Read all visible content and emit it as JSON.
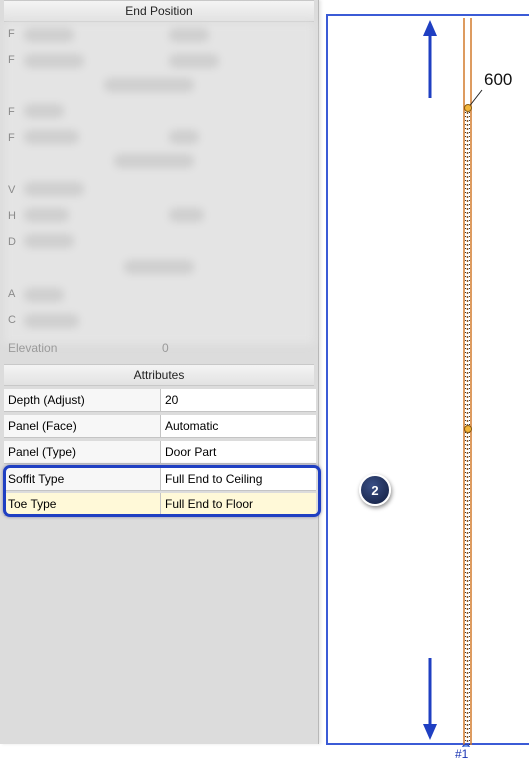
{
  "panel": {
    "end_position_header": "End Position",
    "elevation_label": "Elevation",
    "elevation_value": "0",
    "hint_letters": [
      "F",
      "F",
      "F",
      "F",
      "V",
      "H",
      "D",
      "A",
      "C"
    ],
    "attributes_header": "Attributes",
    "rows": [
      {
        "name": "Depth (Adjust)",
        "value": "20"
      },
      {
        "name": "Panel (Face)",
        "value": "Automatic"
      },
      {
        "name": "Panel (Type)",
        "value": "Door Part"
      },
      {
        "name": "Soffit Type",
        "value": "Full End to Ceiling"
      },
      {
        "name": "Toe Type",
        "value": "Full End to Floor"
      }
    ]
  },
  "drawing": {
    "dimension_label": "600",
    "marker_label": "#1"
  },
  "annotation": {
    "step_number": "2"
  },
  "colors": {
    "annotation_blue": "#1f3fc2",
    "part_orange": "#d27a2c",
    "panel_gray": "#dcdcdc",
    "highlight_yellow": "#fff9d8"
  }
}
